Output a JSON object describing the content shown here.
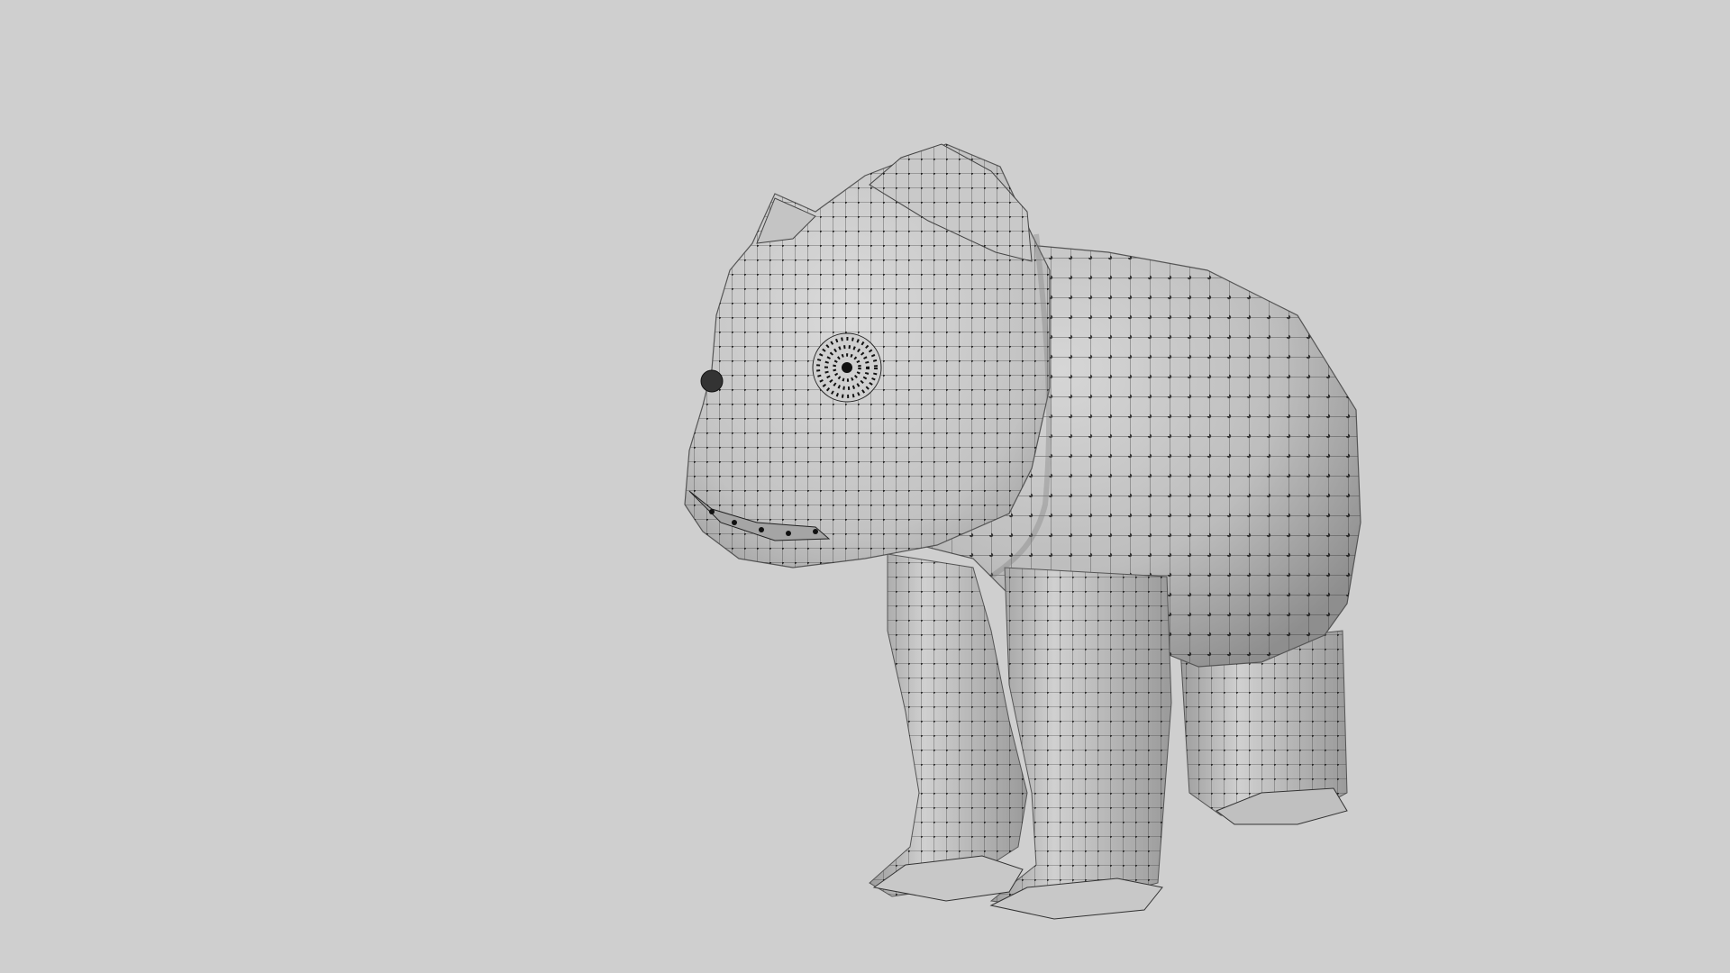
{
  "viewport": {
    "background": "#cfcfcf",
    "object": "3d-wireframe-model",
    "display_mode": "shaded-with-wireframe-and-vertices",
    "mesh_fill": "#b8b8b8",
    "mesh_edge": "#2a2a2a",
    "vertex_color": "#000000"
  }
}
